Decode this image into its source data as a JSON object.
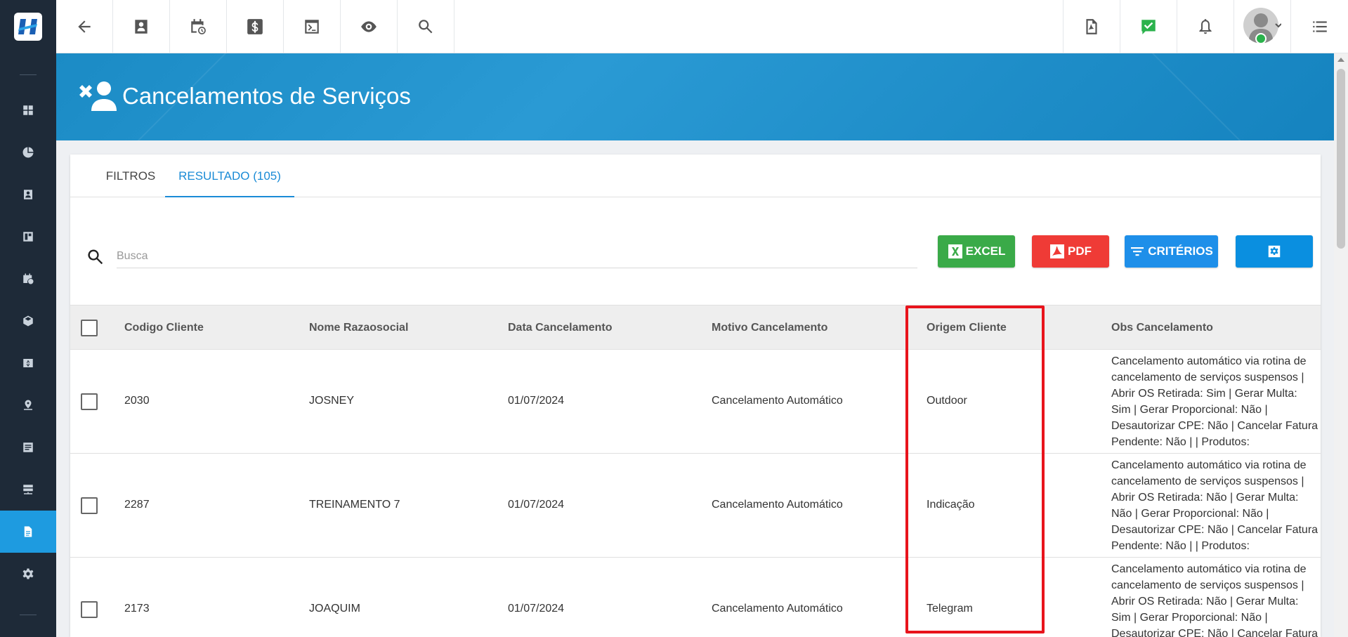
{
  "header": {
    "title": "Cancelamentos de Serviços"
  },
  "tabs": [
    {
      "label": "FILTROS"
    },
    {
      "label": "RESULTADO (105)"
    }
  ],
  "search": {
    "placeholder": "Busca"
  },
  "buttons": {
    "excel": "EXCEL",
    "pdf": "PDF",
    "criterios": "CRITÉRIOS"
  },
  "colors": {
    "excel": "#3aaa48",
    "pdf": "#ef3b36",
    "criterios": "#1e8fe9",
    "settings": "#0a8fe0",
    "sidebar_active": "#1e9be0",
    "highlight": "#e8141c"
  },
  "table": {
    "columns": [
      "Codigo Cliente",
      "Nome Razaosocial",
      "Data Cancelamento",
      "Motivo Cancelamento",
      "Origem Cliente",
      "Obs Cancelamento"
    ],
    "rows": [
      {
        "codigo": "2030",
        "nome": "JOSNEY",
        "data": "01/07/2024",
        "motivo": "Cancelamento Automático",
        "origem": "Outdoor",
        "obs": "Cancelamento automático via rotina de cancelamento de serviços suspensos | Abrir OS Retirada: Sim | Gerar Multa: Sim | Gerar Proporcional: Não | Desautorizar CPE: Não | Cancelar Fatura Pendente: Não | | Produtos:"
      },
      {
        "codigo": "2287",
        "nome": "TREINAMENTO 7",
        "data": "01/07/2024",
        "motivo": "Cancelamento Automático",
        "origem": "Indicação",
        "obs": "Cancelamento automático via rotina de cancelamento de serviços suspensos | Abrir OS Retirada: Não | Gerar Multa: Não | Gerar Proporcional: Não | Desautorizar CPE: Não | Cancelar Fatura Pendente: Não | | Produtos:"
      },
      {
        "codigo": "2173",
        "nome": "JOAQUIM",
        "data": "01/07/2024",
        "motivo": "Cancelamento Automático",
        "origem": "Telegram",
        "obs": "Cancelamento automático via rotina de cancelamento de serviços suspensos | Abrir OS Retirada: Não | Gerar Multa: Sim | Gerar Proporcional: Não | Desautorizar CPE: Não | Cancelar Fatura"
      }
    ]
  },
  "icons": {
    "sidebar": [
      "dashboard-icon",
      "pie-chart-icon",
      "contact-card-icon",
      "board-icon",
      "calendar-clock-icon",
      "package-icon",
      "money-icon",
      "map-pin-icon",
      "list-icon",
      "server-icon",
      "document-icon",
      "gear-icon"
    ],
    "topbar": [
      "back-arrow-icon",
      "contact-card-icon",
      "calendar-clock-icon",
      "dollar-icon",
      "terminal-icon",
      "eye-icon",
      "search-icon",
      "pdf-file-icon",
      "check-message-icon",
      "bell-icon",
      "avatar",
      "menu-icon"
    ]
  }
}
